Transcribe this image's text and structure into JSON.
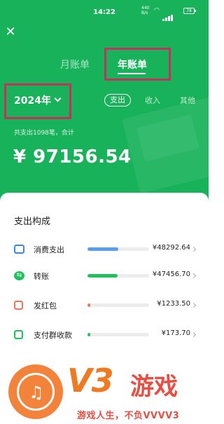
{
  "status_bar": {
    "time": "14:22",
    "speed": "440\nB/s",
    "battery": "78"
  },
  "tabs": {
    "month": "月账单",
    "year": "年账单"
  },
  "year_select": "2024年",
  "type_filters": {
    "expense": "支出",
    "income": "收入",
    "other": "其他"
  },
  "summary": "共支出1098笔，合计",
  "total": "¥ 97156.54",
  "card": {
    "title": "支出构成",
    "rows": [
      {
        "name": "消费支出",
        "amount": "¥48292.64",
        "share": 0.497,
        "color": "#5a9cf2",
        "icon": "wallet-icon"
      },
      {
        "name": "转账",
        "amount": "¥47456.70",
        "share": 0.488,
        "color": "#1fc15b",
        "icon": "transfer-icon"
      },
      {
        "name": "发红包",
        "amount": "¥1233.50",
        "share": 0.013,
        "color": "#f0735c",
        "icon": "red-packet-icon"
      },
      {
        "name": "支付群收款",
        "amount": "¥173.70",
        "share": 0.002,
        "color": "#1fc15b",
        "icon": "group-pay-icon"
      }
    ]
  },
  "watermark": {
    "brand": "V3",
    "brand_cn": "游戏",
    "slogan": "游戏人生，不负VVVV3"
  }
}
